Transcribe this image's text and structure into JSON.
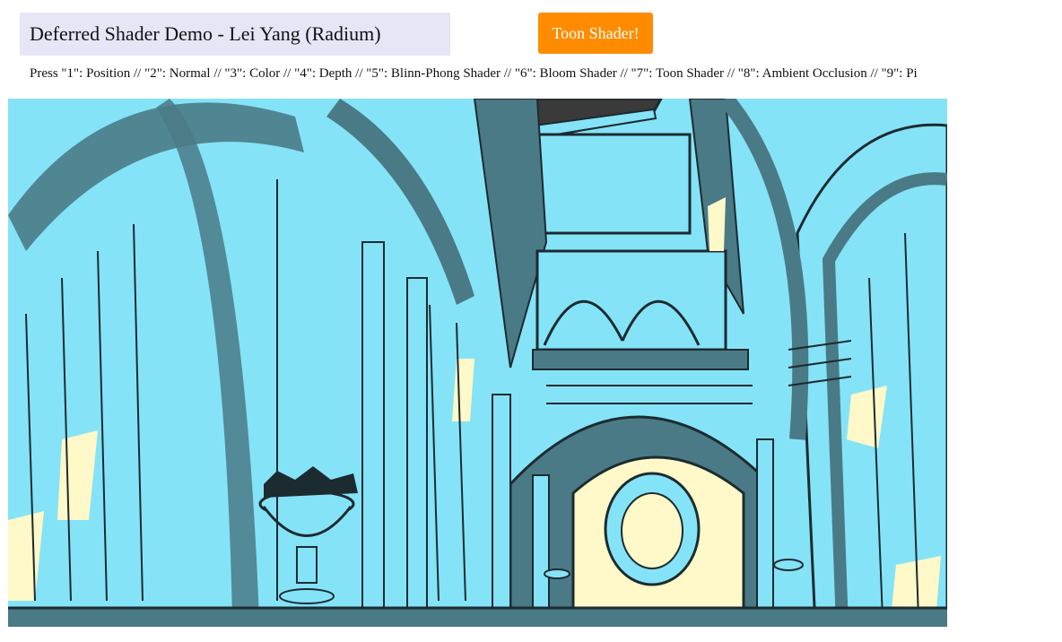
{
  "header": {
    "title": "Deferred Shader Demo - Lei Yang (Radium)",
    "shader_button_label": "Toon Shader!"
  },
  "instructions": "Press \"1\": Position // \"2\": Normal // \"3\": Color // \"4\": Depth // \"5\": Blinn-Phong Shader // \"6\": Bloom Shader // \"7\": Toon Shader // \"8\": Ambient Occlusion // \"9\": Pi",
  "render": {
    "shader_mode": "toon",
    "palette": {
      "light": "#85e3f7",
      "mid": "#4a7a86",
      "dark": "#1c2b30",
      "highlight": "#fff8c8",
      "ceiling": "#3a3a3a"
    }
  }
}
